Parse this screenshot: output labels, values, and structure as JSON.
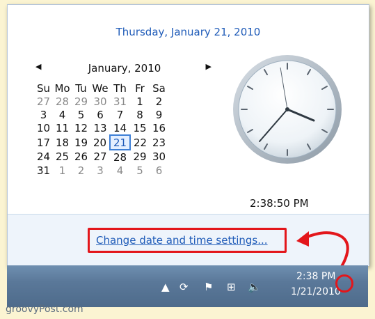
{
  "popup": {
    "long_date": "Thursday, January 21, 2010",
    "month_label": "January, 2010",
    "weekdays": [
      "Su",
      "Mo",
      "Tu",
      "We",
      "Th",
      "Fr",
      "Sa"
    ],
    "weeks": [
      [
        "27",
        "28",
        "29",
        "30",
        "31",
        "1",
        "2"
      ],
      [
        "3",
        "4",
        "5",
        "6",
        "7",
        "8",
        "9"
      ],
      [
        "10",
        "11",
        "12",
        "13",
        "14",
        "15",
        "16"
      ],
      [
        "17",
        "18",
        "19",
        "20",
        "21",
        "22",
        "23"
      ],
      [
        "24",
        "25",
        "26",
        "27",
        "28",
        "29",
        "30"
      ],
      [
        "31",
        "1",
        "2",
        "3",
        "4",
        "5",
        "6"
      ]
    ],
    "time": "2:38:50 PM",
    "change_link": "Change date and time settings..."
  },
  "taskbar": {
    "time": "2:38 PM",
    "date": "1/21/2010"
  },
  "watermark": "groovyPost.com",
  "colors": {
    "accent": "#1f5bb8",
    "highlight": "#e3161b"
  }
}
